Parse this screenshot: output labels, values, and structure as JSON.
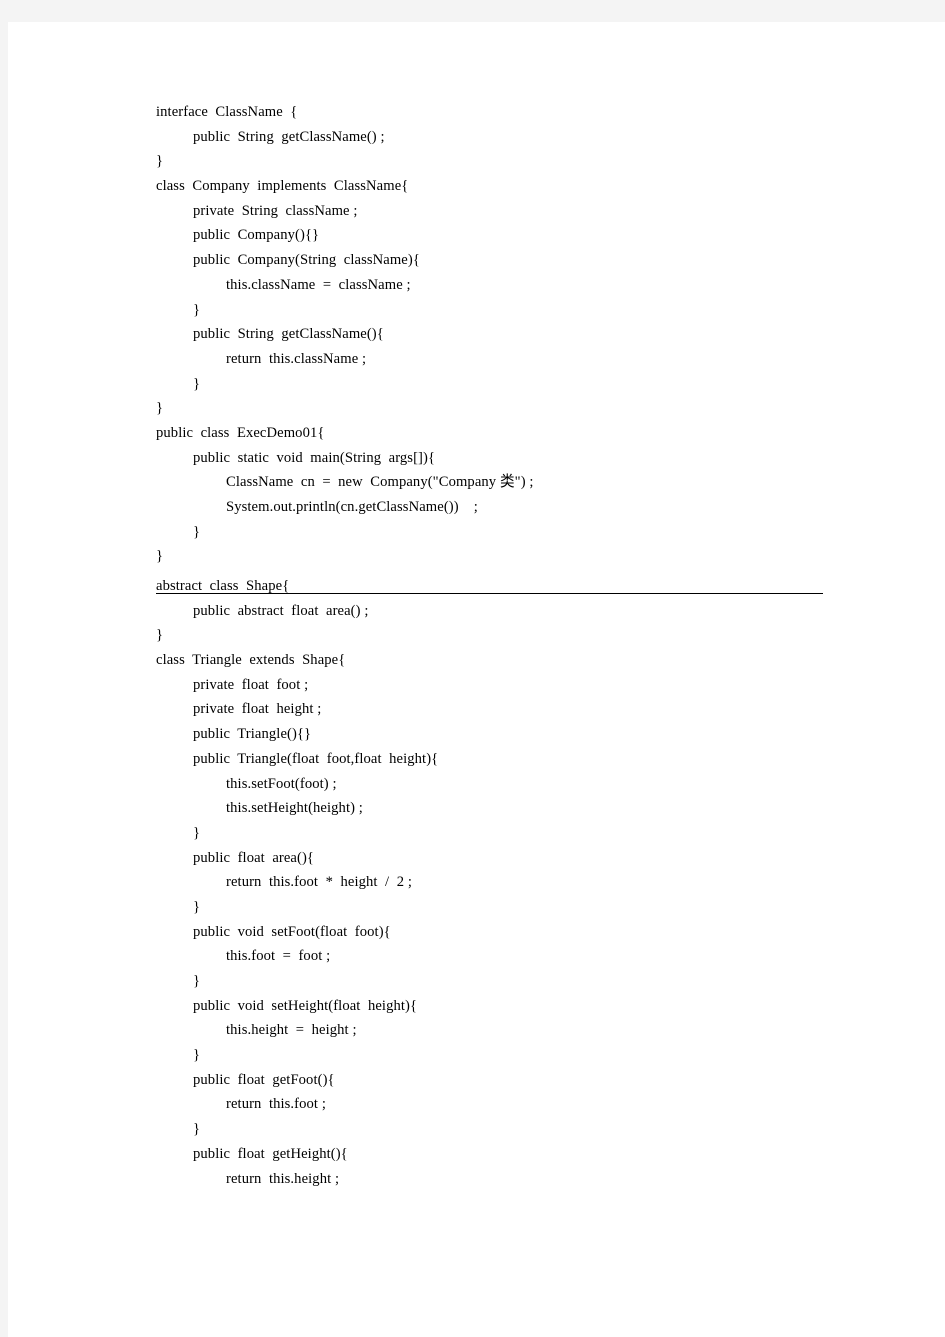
{
  "document": {
    "type": "java-source-listing",
    "page_background": "#ffffff",
    "canvas_background": "#f4f4f4",
    "text_color": "#000000",
    "divider_color": "#000000"
  },
  "listings": [
    {
      "id": "exec-demo-01",
      "lines": [
        {
          "indent": 0,
          "text": "interface  ClassName  {"
        },
        {
          "indent": 1,
          "text": "public  String  getClassName() ;"
        },
        {
          "indent": 0,
          "text": "}"
        },
        {
          "indent": 0,
          "text": "class  Company  implements  ClassName{"
        },
        {
          "indent": 1,
          "text": "private  String  className ;"
        },
        {
          "indent": 1,
          "text": "public  Company(){}"
        },
        {
          "indent": 1,
          "text": "public  Company(String  className){"
        },
        {
          "indent": 2,
          "text": "this.className  =  className ;"
        },
        {
          "indent": 1,
          "text": "}"
        },
        {
          "indent": 1,
          "text": "public  String  getClassName(){"
        },
        {
          "indent": 2,
          "text": "return  this.className ;"
        },
        {
          "indent": 1,
          "text": "}"
        },
        {
          "indent": 0,
          "text": "}"
        },
        {
          "indent": 0,
          "text": "public  class  ExecDemo01{"
        },
        {
          "indent": 1,
          "text": "public  static  void  main(String  args[]){"
        },
        {
          "indent": 2,
          "text": "ClassName  cn  =  new  Company(\"Company 类\") ;"
        },
        {
          "indent": 2,
          "text": "System.out.println(cn.getClassName())    ;"
        },
        {
          "indent": 1,
          "text": "}"
        },
        {
          "indent": 0,
          "text": "}"
        }
      ]
    },
    {
      "id": "shape-triangle",
      "lines": [
        {
          "indent": 0,
          "text": "abstract  class  Shape{"
        },
        {
          "indent": 1,
          "text": "public  abstract  float  area() ;"
        },
        {
          "indent": 0,
          "text": "}"
        },
        {
          "indent": 0,
          "text": "class  Triangle  extends  Shape{"
        },
        {
          "indent": 1,
          "text": "private  float  foot ;"
        },
        {
          "indent": 1,
          "text": "private  float  height ;"
        },
        {
          "indent": 1,
          "text": "public  Triangle(){}"
        },
        {
          "indent": 1,
          "text": "public  Triangle(float  foot,float  height){"
        },
        {
          "indent": 2,
          "text": "this.setFoot(foot) ;"
        },
        {
          "indent": 2,
          "text": "this.setHeight(height) ;"
        },
        {
          "indent": 1,
          "text": "}"
        },
        {
          "indent": 1,
          "text": "public  float  area(){"
        },
        {
          "indent": 2,
          "text": "return  this.foot  *  height  /  2 ;"
        },
        {
          "indent": 1,
          "text": "}"
        },
        {
          "indent": 1,
          "text": "public  void  setFoot(float  foot){"
        },
        {
          "indent": 2,
          "text": "this.foot  =  foot ;"
        },
        {
          "indent": 1,
          "text": "}"
        },
        {
          "indent": 1,
          "text": "public  void  setHeight(float  height){"
        },
        {
          "indent": 2,
          "text": "this.height  =  height ;"
        },
        {
          "indent": 1,
          "text": "}"
        },
        {
          "indent": 1,
          "text": "public  float  getFoot(){"
        },
        {
          "indent": 2,
          "text": "return  this.foot ;"
        },
        {
          "indent": 1,
          "text": "}"
        },
        {
          "indent": 1,
          "text": "public  float  getHeight(){"
        },
        {
          "indent": 2,
          "text": "return  this.height ;"
        }
      ]
    }
  ]
}
